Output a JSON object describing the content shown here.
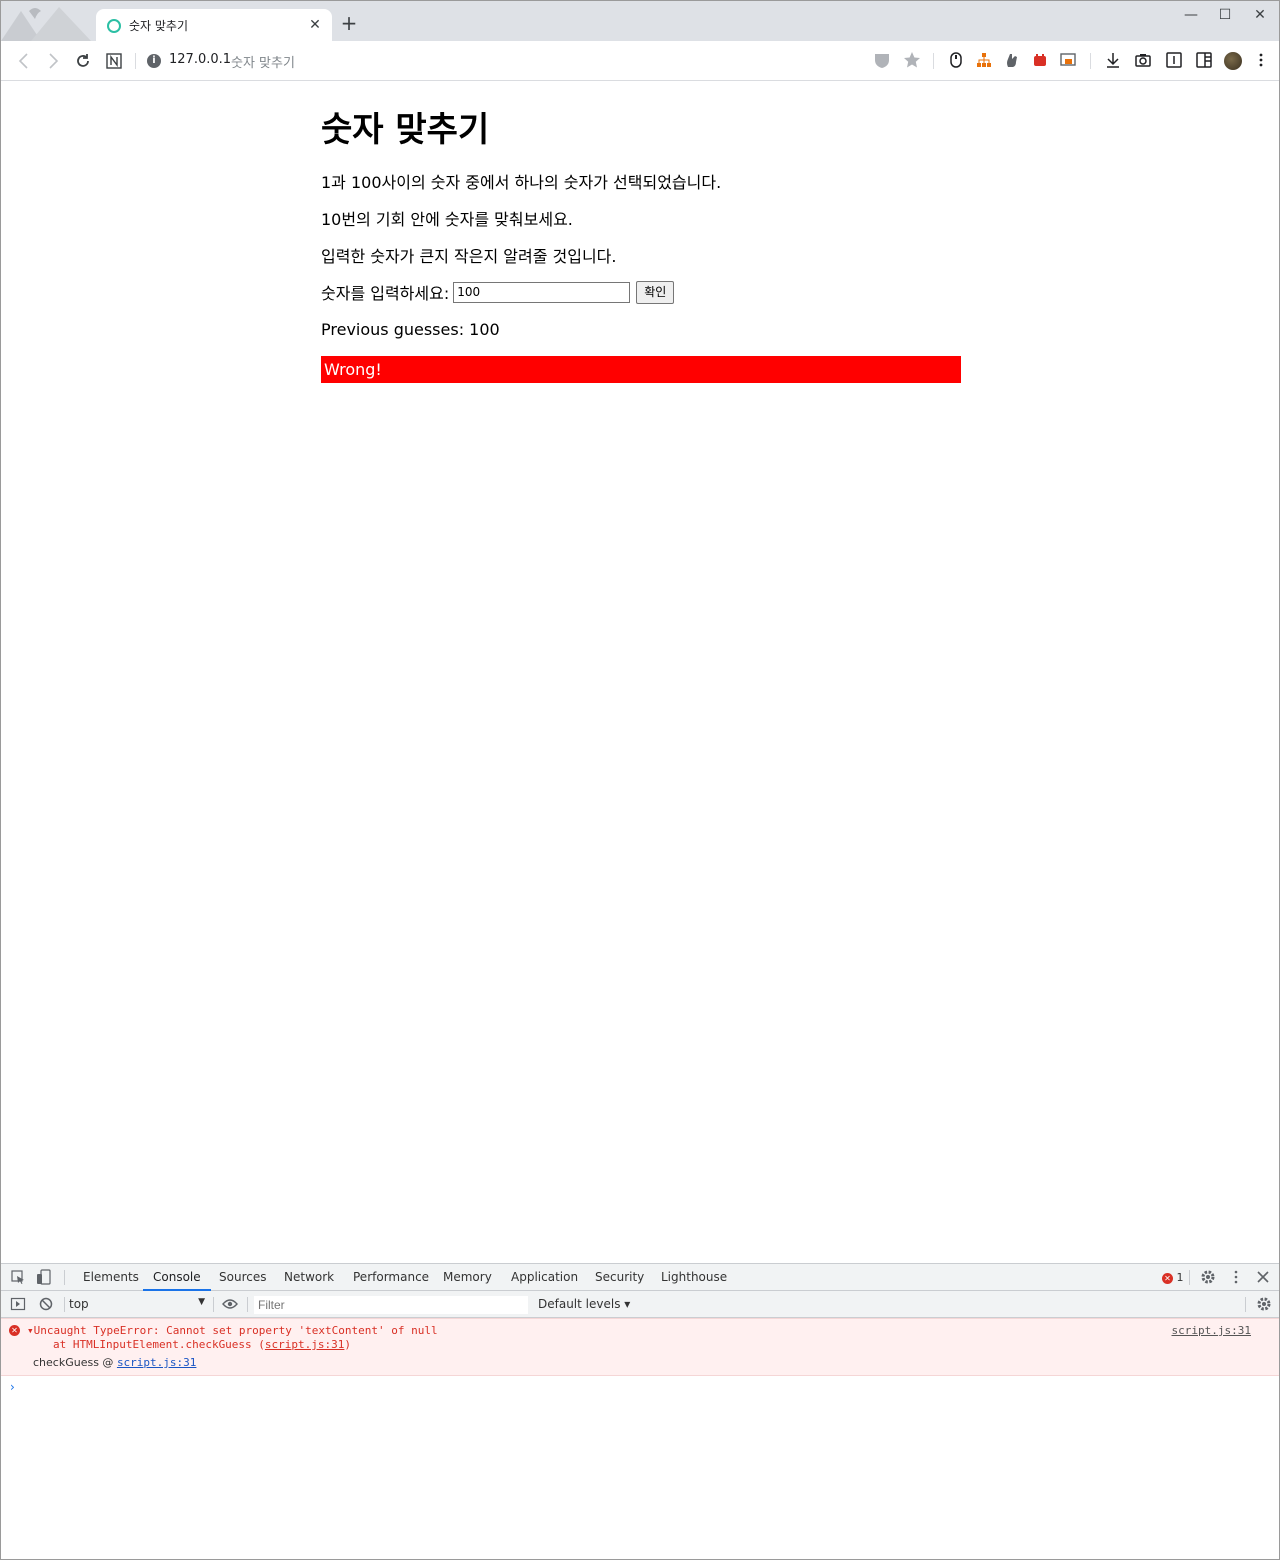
{
  "browser": {
    "tab_title": "숫자 맞추기",
    "tab_close": "✕",
    "new_tab": "+",
    "window_controls": {
      "minimize": "—",
      "maximize": "☐",
      "close": "✕"
    },
    "url_host": "127.0.0.1",
    "url_title": "숫자 맞추기"
  },
  "page": {
    "heading": "숫자 맞추기",
    "paragraphs": [
      "1과 100사이의 숫자 중에서 하나의 숫자가 선택되었습니다.",
      "10번의 기회 안에 숫자를 맞춰보세요.",
      "입력한 숫자가 큰지 작은지 알려줄 것입니다."
    ],
    "guess_label": "숫자를 입력하세요:",
    "guess_value": "100",
    "submit_label": "확인",
    "previous_guesses": "Previous guesses: 100",
    "last_result": "Wrong!",
    "result_color": "#ff0000"
  },
  "devtools": {
    "tabs": [
      "Elements",
      "Console",
      "Sources",
      "Network",
      "Performance",
      "Memory",
      "Application",
      "Security",
      "Lighthouse"
    ],
    "active_tab": "Console",
    "error_count": "1",
    "context": "top",
    "filter_placeholder": "Filter",
    "levels": "Default levels ▾",
    "error": {
      "message": "▾Uncaught TypeError: Cannot set property 'textContent' of null",
      "at_prefix": "at HTMLInputElement.checkGuess (",
      "at_link": "script.js:31",
      "at_suffix": ")",
      "source": "script.js:31",
      "stack_fn": "checkGuess @ ",
      "stack_link": "script.js:31"
    },
    "prompt": "›"
  }
}
